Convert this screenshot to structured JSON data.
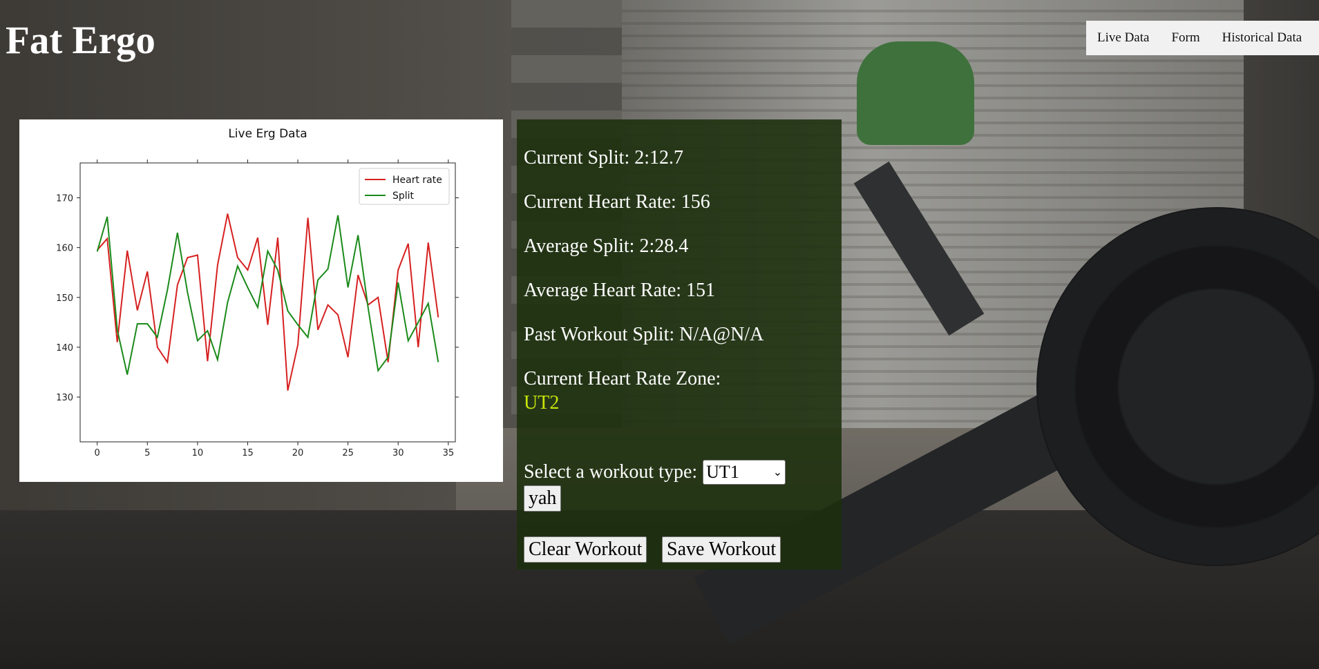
{
  "site": {
    "title": "Fat Ergo"
  },
  "nav": {
    "items": [
      "Live Data",
      "Form",
      "Historical Data"
    ]
  },
  "stats": {
    "current_split": "Current Split: 2:12.7",
    "current_hr": "Current Heart Rate: 156",
    "avg_split": "Average Split: 2:28.4",
    "avg_hr": "Average Heart Rate: 151",
    "past_split": "Past Workout Split: N/A@N/A",
    "zone_label": "Current Heart Rate Zone:",
    "zone_value": "UT2",
    "zone_color": "#c9e60a"
  },
  "workout": {
    "select_label": "Select a workout type:",
    "selected": "UT1",
    "submit_label": "yah",
    "clear_label": "Clear Workout",
    "save_label": "Save Workout"
  },
  "chart_data": {
    "type": "line",
    "title": "Live Erg Data",
    "xlabel": "",
    "ylabel": "",
    "xlim": [
      -1.7,
      35.7
    ],
    "ylim": [
      121,
      177
    ],
    "xticks": [
      0,
      5,
      10,
      15,
      20,
      25,
      30,
      35
    ],
    "yticks": [
      130,
      140,
      150,
      160,
      170
    ],
    "legend_position": "top-right",
    "x": [
      0,
      1,
      2,
      3,
      4,
      5,
      6,
      7,
      8,
      9,
      10,
      11,
      12,
      13,
      14,
      15,
      16,
      17,
      18,
      19,
      20,
      21,
      22,
      23,
      24,
      25,
      26,
      27,
      28,
      29,
      30,
      31,
      32,
      33,
      34
    ],
    "series": [
      {
        "name": "Heart rate",
        "color": "#d62020",
        "values": [
          159.5,
          161.8,
          141,
          159.4,
          147.4,
          155.2,
          140,
          137,
          152.5,
          158,
          158.5,
          137.2,
          156.5,
          166.8,
          158,
          155.5,
          162,
          144.5,
          162,
          131.3,
          140.5,
          166,
          143.5,
          148.5,
          146.5,
          138,
          154.5,
          148.5,
          150,
          137,
          155.5,
          160.8,
          140,
          161,
          146
        ]
      },
      {
        "name": "Split",
        "color": "#1a8a1a",
        "values": [
          159.2,
          166.2,
          143.5,
          134.5,
          144.7,
          144.7,
          142,
          151.5,
          163,
          151,
          141.3,
          143.3,
          137.5,
          149,
          156.3,
          152,
          148,
          159.3,
          155.5,
          147.3,
          144.5,
          142,
          153.5,
          155.7,
          166.5,
          152,
          162.5,
          148,
          135.3,
          138,
          153,
          141.3,
          145,
          148.8,
          137
        ]
      }
    ]
  }
}
